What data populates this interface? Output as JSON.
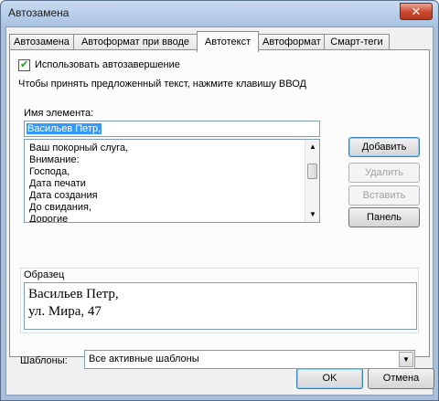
{
  "window": {
    "title": "Автозамена",
    "close_symbol": "✕"
  },
  "tabs": [
    {
      "label": "Автозамена",
      "active": false
    },
    {
      "label": "Автоформат при вводе",
      "active": false
    },
    {
      "label": "Автотекст",
      "active": true
    },
    {
      "label": "Автоформат",
      "active": false
    },
    {
      "label": "Смарт-теги",
      "active": false
    }
  ],
  "autotext": {
    "use_autocomplete_label": "Использовать автозавершение",
    "use_autocomplete_checked": true,
    "hint": "Чтобы принять предложенный текст, нажмите клавишу ВВОД",
    "element_name_label": "Имя элемента:",
    "element_name_value": "Васильев Петр,",
    "entries": [
      "Ваш покорный слуга,",
      "Внимание:",
      "Господа,",
      "Дата печати",
      "Дата создания",
      "До свидания,",
      "Дорогие"
    ],
    "buttons": {
      "add": "Добавить",
      "delete": "Удалить",
      "insert": "Вставить",
      "toolbar": "Панель"
    },
    "sample_label": "Образец",
    "sample_lines": [
      "Васильев Петр,",
      "ул. Мира, 47"
    ],
    "templates_label": "Шаблоны:",
    "templates_value": "Все активные шаблоны"
  },
  "footer": {
    "ok": "OK",
    "cancel": "Отмена"
  },
  "icons": {
    "checkbox_mark": "✔",
    "scroll_up": "▲",
    "scroll_down": "▼",
    "dropdown": "▼"
  }
}
